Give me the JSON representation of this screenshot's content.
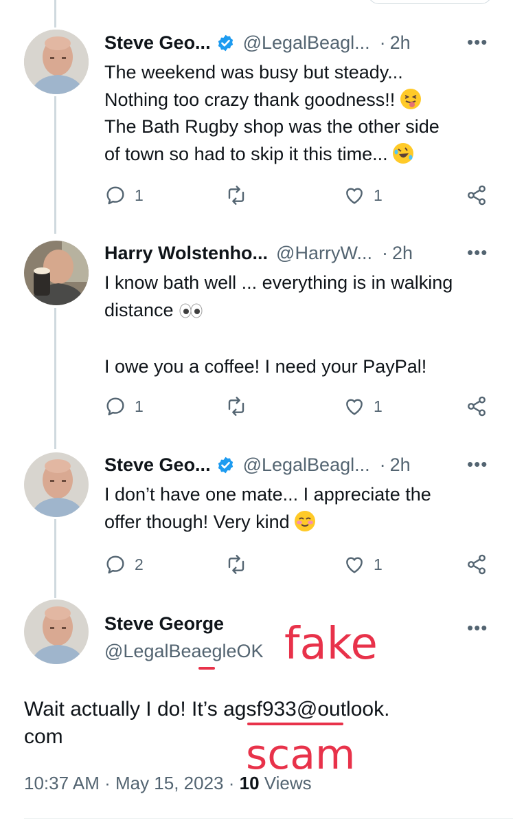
{
  "tweets": [
    {
      "name": "Steve Geo...",
      "handle": "@LegalBeagl...",
      "time": "2h",
      "more": "•••",
      "line1": "The weekend was busy but steady...",
      "line2": "Nothing too crazy thank goodness!!",
      "line3": "The Bath Rugby shop was the other side",
      "line4": "of town so had to skip it this time...",
      "replies": "1",
      "likes": "1"
    },
    {
      "name": "Harry Wolstenho...",
      "handle": "@HarryW...",
      "time": "2h",
      "more": "•••",
      "line1": "I know bath well ... everything is in walking",
      "line2": "distance",
      "line3": "I owe you a coffee! I need your PayPal!",
      "replies": "1",
      "likes": "1"
    },
    {
      "name": "Steve Geo...",
      "handle": "@LegalBeagl...",
      "time": "2h",
      "more": "•••",
      "line1": "I don’t have one mate... I appreciate the",
      "line2": "offer though! Very kind",
      "replies": "2",
      "likes": "1"
    }
  ],
  "main_tweet": {
    "name": "Steve George",
    "handle": "@LegalBeaegleOK",
    "more": "•••",
    "text_line1": "Wait actually I do! It’s agsf933@outlook.",
    "text_line2": "com",
    "timestamp": "10:37 AM · May 15, 2023 · ",
    "views_count": "10",
    "views_label": " Views"
  },
  "annotations": {
    "fake": "fake",
    "scam": "scam",
    "color": "#e8324a"
  },
  "colors": {
    "verified": "#1d9bf0",
    "secondary_text": "#536471",
    "thread_line": "#cfd9de"
  },
  "icons": [
    "verified-badge-icon",
    "reply-icon",
    "retweet-icon",
    "like-icon",
    "share-icon",
    "more-icon"
  ]
}
